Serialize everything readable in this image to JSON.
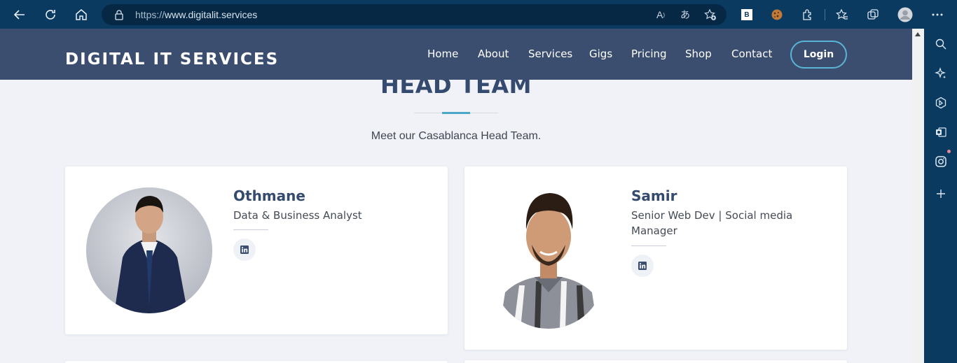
{
  "browser": {
    "url_protocol": "https://",
    "url_host": "www.digitalit.services",
    "toolbar_icons": [
      "back-icon",
      "refresh-icon",
      "home-icon",
      "read-aloud-icon",
      "translate-icon",
      "add-favorite-icon",
      "extension-b-icon",
      "cookie-extension-icon",
      "extensions-icon",
      "favorites-icon",
      "collections-icon",
      "profile-icon",
      "more-icon"
    ],
    "extension_b_label": "B",
    "sidebar_icons": [
      "search-icon",
      "copilot-icon",
      "bing-icon",
      "outlook-icon",
      "instagram-icon",
      "add-icon"
    ]
  },
  "site": {
    "logo": "DIGITAL IT SERVICES",
    "nav": [
      "Home",
      "About",
      "Services",
      "Gigs",
      "Pricing",
      "Shop",
      "Contact"
    ],
    "login": "Login"
  },
  "section": {
    "title": "HEAD TEAM",
    "subtitle": "Meet our Casablanca Head Team."
  },
  "team": [
    {
      "name": "Othmane",
      "role": "Data & Business Analyst",
      "social": "linkedin-icon"
    },
    {
      "name": "Samir",
      "role_line1": "Senior Web Dev | Social media",
      "role_line2": "Manager",
      "social": "linkedin-icon"
    }
  ],
  "colors": {
    "browser_chrome": "#0b3a60",
    "header": "#3b4e6f",
    "accent": "#4aa9c9",
    "title": "#344a6e",
    "page_bg": "#f0f2f8"
  }
}
